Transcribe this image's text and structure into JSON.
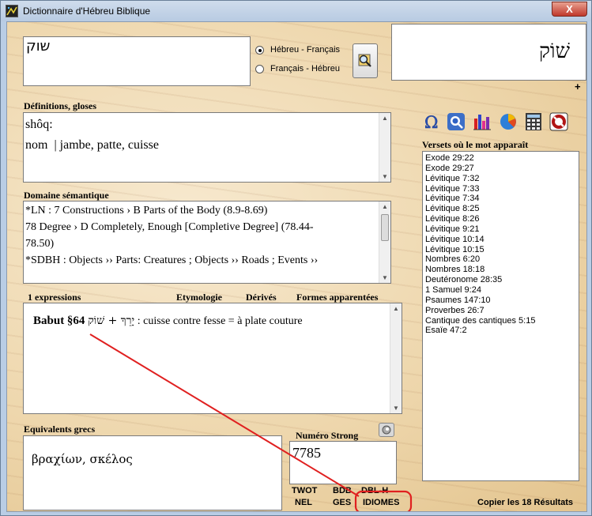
{
  "window": {
    "title": "Dictionnaire d'Hébreu Biblique",
    "close_label": "X"
  },
  "search": {
    "value": "שוק",
    "options": [
      "Hébreu - Français",
      "Français - Hébreu"
    ],
    "selected_option": "Hébreu - Français"
  },
  "word_display": {
    "hebrew": "שׁוֹק"
  },
  "plus_label": "+",
  "definitions": {
    "heading": "Définitions, gloses",
    "transliteration": "shôq:",
    "gloss": "nom  | jambe, patte, cuisse"
  },
  "semantic_domain": {
    "heading": "Domaine sémantique",
    "lines": [
      "*LN : 7 Constructions › B Parts of the Body (8.9-8.69)",
      "78 Degree › D Completely, Enough [Completive Degree] (78.44-",
      "78.50)",
      "*SDBH : Objects ›› Parts: Creatures ; Objects ›› Roads ; Events ››"
    ]
  },
  "expressions": {
    "count_label": "1 expressions",
    "tabs": [
      "Etymologie",
      "Dérivés",
      "Formes apparentées"
    ],
    "entry_ref": "Babut §64",
    "entry_hebrew": "יָרֵךְ + שׁוֹק",
    "entry_text": " : cuisse contre fesse = à plate couture"
  },
  "greek": {
    "heading": "Equivalents grecs",
    "value": "βραχίων, σκέλος"
  },
  "strong": {
    "heading": "Numéro Strong",
    "value": "7785"
  },
  "verses": {
    "heading": "Versets où le mot apparaît",
    "items": [
      "Exode 29:22",
      "Exode 29:27",
      "Lévitique 7:32",
      "Lévitique 7:33",
      "Lévitique 7:34",
      "Lévitique 8:25",
      "Lévitique 8:26",
      "Lévitique 9:21",
      "Lévitique 10:14",
      "Lévitique 10:15",
      "Nombres 6:20",
      "Nombres 18:18",
      "Deutéronome 28:35",
      "1 Samuel 9:24",
      "Psaumes 147:10",
      "Proverbes 26:7",
      "Cantique des cantiques 5:15",
      "Esaïe 47:2"
    ],
    "copy_label": "Copier les 18 Résultats"
  },
  "bottom_links": {
    "twot": "TWOT",
    "nel": "NEL",
    "bdb": "BDB",
    "ges": "GES",
    "dbl": "DBL-H",
    "idiomes": "IDIOMES"
  },
  "annotation_color": "#e02020",
  "toolbar_icons": [
    "omega-icon",
    "search-globe-icon",
    "bar-chart-icon",
    "pie-chart-icon",
    "grid-calculator-icon",
    "stop-icon"
  ]
}
